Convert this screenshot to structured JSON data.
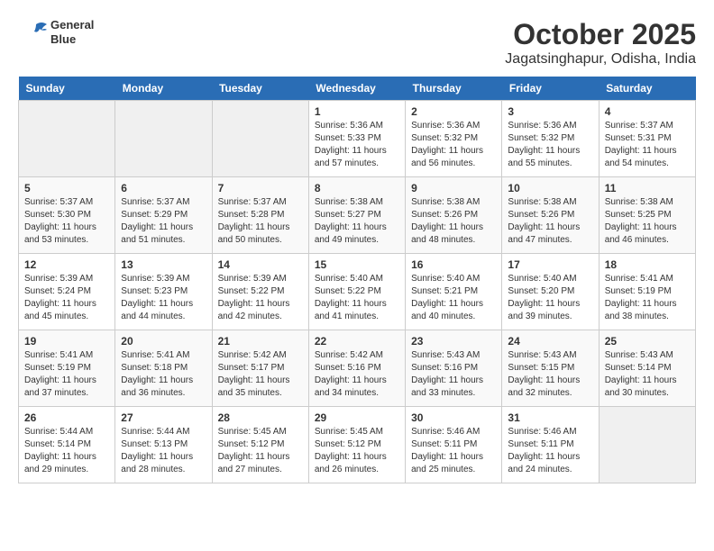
{
  "logo": {
    "line1": "General",
    "line2": "Blue"
  },
  "title": "October 2025",
  "subtitle": "Jagatsinghapur, Odisha, India",
  "weekdays": [
    "Sunday",
    "Monday",
    "Tuesday",
    "Wednesday",
    "Thursday",
    "Friday",
    "Saturday"
  ],
  "weeks": [
    [
      {
        "day": "",
        "empty": true
      },
      {
        "day": "",
        "empty": true
      },
      {
        "day": "",
        "empty": true
      },
      {
        "day": "1",
        "sunrise": "5:36 AM",
        "sunset": "5:33 PM",
        "daylight": "11 hours and 57 minutes."
      },
      {
        "day": "2",
        "sunrise": "5:36 AM",
        "sunset": "5:32 PM",
        "daylight": "11 hours and 56 minutes."
      },
      {
        "day": "3",
        "sunrise": "5:36 AM",
        "sunset": "5:32 PM",
        "daylight": "11 hours and 55 minutes."
      },
      {
        "day": "4",
        "sunrise": "5:37 AM",
        "sunset": "5:31 PM",
        "daylight": "11 hours and 54 minutes."
      }
    ],
    [
      {
        "day": "5",
        "sunrise": "5:37 AM",
        "sunset": "5:30 PM",
        "daylight": "11 hours and 53 minutes."
      },
      {
        "day": "6",
        "sunrise": "5:37 AM",
        "sunset": "5:29 PM",
        "daylight": "11 hours and 51 minutes."
      },
      {
        "day": "7",
        "sunrise": "5:37 AM",
        "sunset": "5:28 PM",
        "daylight": "11 hours and 50 minutes."
      },
      {
        "day": "8",
        "sunrise": "5:38 AM",
        "sunset": "5:27 PM",
        "daylight": "11 hours and 49 minutes."
      },
      {
        "day": "9",
        "sunrise": "5:38 AM",
        "sunset": "5:26 PM",
        "daylight": "11 hours and 48 minutes."
      },
      {
        "day": "10",
        "sunrise": "5:38 AM",
        "sunset": "5:26 PM",
        "daylight": "11 hours and 47 minutes."
      },
      {
        "day": "11",
        "sunrise": "5:38 AM",
        "sunset": "5:25 PM",
        "daylight": "11 hours and 46 minutes."
      }
    ],
    [
      {
        "day": "12",
        "sunrise": "5:39 AM",
        "sunset": "5:24 PM",
        "daylight": "11 hours and 45 minutes."
      },
      {
        "day": "13",
        "sunrise": "5:39 AM",
        "sunset": "5:23 PM",
        "daylight": "11 hours and 44 minutes."
      },
      {
        "day": "14",
        "sunrise": "5:39 AM",
        "sunset": "5:22 PM",
        "daylight": "11 hours and 42 minutes."
      },
      {
        "day": "15",
        "sunrise": "5:40 AM",
        "sunset": "5:22 PM",
        "daylight": "11 hours and 41 minutes."
      },
      {
        "day": "16",
        "sunrise": "5:40 AM",
        "sunset": "5:21 PM",
        "daylight": "11 hours and 40 minutes."
      },
      {
        "day": "17",
        "sunrise": "5:40 AM",
        "sunset": "5:20 PM",
        "daylight": "11 hours and 39 minutes."
      },
      {
        "day": "18",
        "sunrise": "5:41 AM",
        "sunset": "5:19 PM",
        "daylight": "11 hours and 38 minutes."
      }
    ],
    [
      {
        "day": "19",
        "sunrise": "5:41 AM",
        "sunset": "5:19 PM",
        "daylight": "11 hours and 37 minutes."
      },
      {
        "day": "20",
        "sunrise": "5:41 AM",
        "sunset": "5:18 PM",
        "daylight": "11 hours and 36 minutes."
      },
      {
        "day": "21",
        "sunrise": "5:42 AM",
        "sunset": "5:17 PM",
        "daylight": "11 hours and 35 minutes."
      },
      {
        "day": "22",
        "sunrise": "5:42 AM",
        "sunset": "5:16 PM",
        "daylight": "11 hours and 34 minutes."
      },
      {
        "day": "23",
        "sunrise": "5:43 AM",
        "sunset": "5:16 PM",
        "daylight": "11 hours and 33 minutes."
      },
      {
        "day": "24",
        "sunrise": "5:43 AM",
        "sunset": "5:15 PM",
        "daylight": "11 hours and 32 minutes."
      },
      {
        "day": "25",
        "sunrise": "5:43 AM",
        "sunset": "5:14 PM",
        "daylight": "11 hours and 30 minutes."
      }
    ],
    [
      {
        "day": "26",
        "sunrise": "5:44 AM",
        "sunset": "5:14 PM",
        "daylight": "11 hours and 29 minutes."
      },
      {
        "day": "27",
        "sunrise": "5:44 AM",
        "sunset": "5:13 PM",
        "daylight": "11 hours and 28 minutes."
      },
      {
        "day": "28",
        "sunrise": "5:45 AM",
        "sunset": "5:12 PM",
        "daylight": "11 hours and 27 minutes."
      },
      {
        "day": "29",
        "sunrise": "5:45 AM",
        "sunset": "5:12 PM",
        "daylight": "11 hours and 26 minutes."
      },
      {
        "day": "30",
        "sunrise": "5:46 AM",
        "sunset": "5:11 PM",
        "daylight": "11 hours and 25 minutes."
      },
      {
        "day": "31",
        "sunrise": "5:46 AM",
        "sunset": "5:11 PM",
        "daylight": "11 hours and 24 minutes."
      },
      {
        "day": "",
        "empty": true
      }
    ]
  ]
}
